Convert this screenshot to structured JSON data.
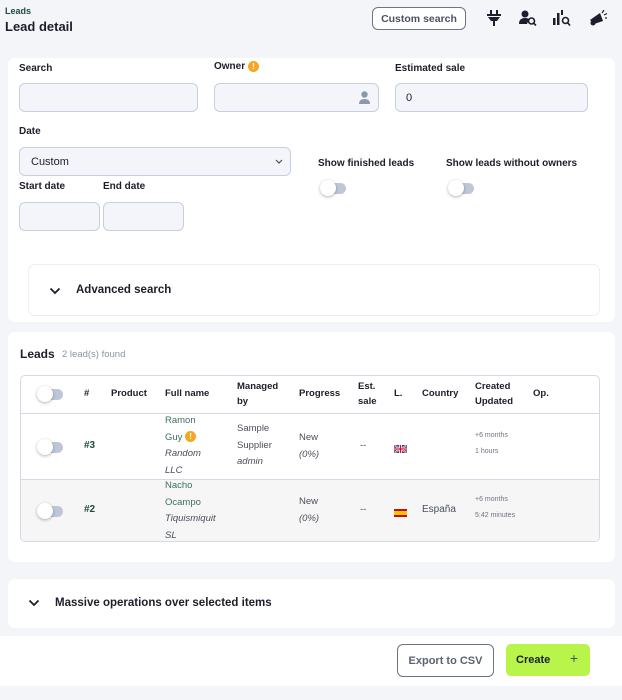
{
  "header": {
    "breadcrumb": "Leads",
    "title": "Lead detail",
    "custom_search_label": "Custom search",
    "icons": [
      "plug-icon",
      "user-search-icon",
      "chart-search-icon",
      "megaphone-icon"
    ]
  },
  "filters": {
    "search": {
      "label": "Search",
      "value": ""
    },
    "owner": {
      "label": "Owner",
      "value": "",
      "info_icon": "info-icon"
    },
    "estimated_sale": {
      "label": "Estimated sale",
      "value": "0"
    },
    "date": {
      "label": "Date",
      "selected": "Custom"
    },
    "start_date": {
      "label": "Start date",
      "value": ""
    },
    "end_date": {
      "label": "End date",
      "value": ""
    },
    "show_finished": {
      "label": "Show finished leads",
      "on": false
    },
    "show_without_owners": {
      "label": "Show leads without owners",
      "on": false
    },
    "advanced_search": "Advanced search"
  },
  "leads": {
    "title": "Leads",
    "count_text": "2 lead(s) found",
    "columns": [
      "#",
      "Product",
      "Full name",
      "Managed by",
      "Progress",
      "Est. sale",
      "L.",
      "Country",
      "Created Updated",
      "Op."
    ],
    "columns_lines": {
      "managed": [
        "Managed",
        "by"
      ],
      "est": [
        "Est.",
        "sale"
      ],
      "created": [
        "Created",
        "Updated"
      ]
    },
    "rows": [
      {
        "id": "#3",
        "product": "",
        "name_line1": "Ramon",
        "name_line2": "Guy",
        "has_info": true,
        "company_line1": "Random",
        "company_line2": "LLC",
        "managed_line1": "Sample",
        "managed_line2": "Supplier",
        "managed_line3": "admin",
        "progress": "New",
        "progress_pct": "(0%)",
        "est_sale": "--",
        "language": "en",
        "country": "",
        "created": "+6 months",
        "updated": "1 hours"
      },
      {
        "id": "#2",
        "product": "",
        "name_line1": "Nacho",
        "name_line2": "Ocampo",
        "has_info": false,
        "company_line1": "Tiquismiquit",
        "company_line2": "SL",
        "managed_line1": "",
        "managed_line2": "",
        "managed_line3": "",
        "progress": "New",
        "progress_pct": "(0%)",
        "est_sale": "--",
        "language": "es",
        "country": "España",
        "created": "+6 months",
        "updated": "5:42 minutes"
      }
    ]
  },
  "massive_ops": "Massive operations over selected items",
  "footer": {
    "export_label": "Export to CSV",
    "create_label": "Create",
    "create_icon": "+"
  },
  "colors": {
    "accent": "#b8f44a",
    "brand_dark": "#1f4a3f",
    "warning": "#f5a623"
  }
}
